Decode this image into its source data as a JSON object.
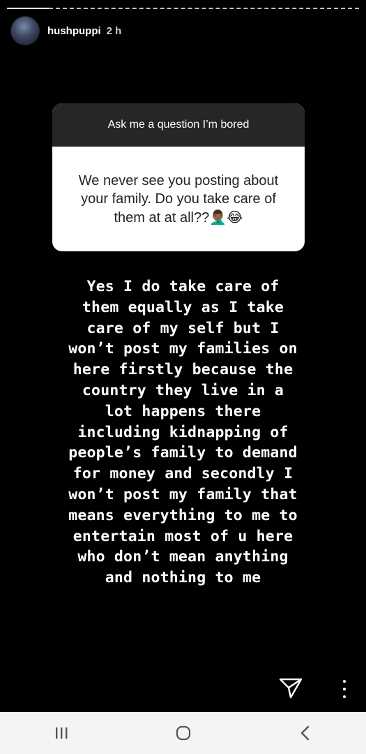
{
  "story": {
    "username": "hushpuppi",
    "time_ago": "2 h"
  },
  "question_sticker": {
    "prompt": "Ask me a question I’m bored",
    "question": "We never see you posting about your family. Do you take care of them at at all??",
    "emojis": "🤦🏾‍♂️😂"
  },
  "answer": {
    "text": "Yes I do take care of\nthem equally as I take\ncare of my self but I\nwon’t post my families on\nhere firstly because the\ncountry they live in a\nlot happens there\nincluding kidnapping of\npeople’s family to demand\nfor money and secondly I\nwon’t post my family that\nmeans everything to me to\nentertain most of u here\nwho don’t mean anything\nand nothing to me"
  },
  "icons": {
    "send": "paper-plane-icon",
    "more": "vertical-dots-icon",
    "nav_recents": "recents-icon",
    "nav_home": "home-icon",
    "nav_back": "back-icon"
  },
  "colors": {
    "background": "#000000",
    "sticker_header": "#262626",
    "sticker_body": "#ffffff",
    "navbar": "#f4f4f4"
  }
}
